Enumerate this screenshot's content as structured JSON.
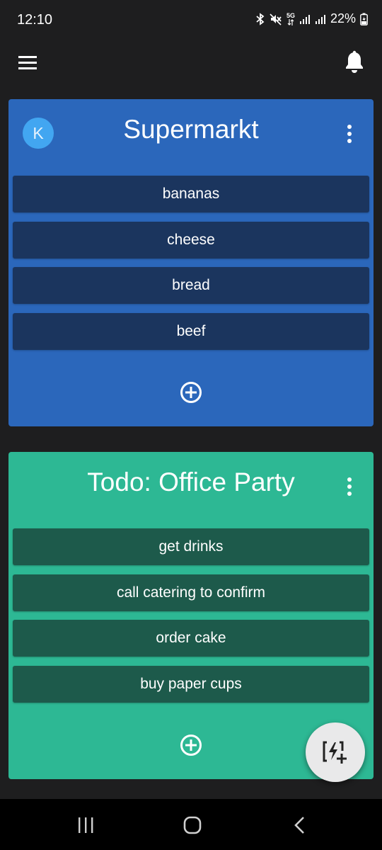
{
  "status_bar": {
    "time": "12:10",
    "network_label": "5G",
    "battery_text": "22%"
  },
  "app_bar": {
    "menu_icon": "menu-icon",
    "notification_icon": "bell-icon"
  },
  "lists": [
    {
      "avatar_letter": "K",
      "title": "Supermarkt",
      "color": "#2b67bb",
      "item_color": "#1b355e",
      "items": [
        "bananas",
        "cheese",
        "bread",
        "beef"
      ]
    },
    {
      "avatar_letter": "",
      "title": "Todo: Office Party",
      "color": "#2db894",
      "item_color": "#1d5a4b",
      "items": [
        "get drinks",
        "call catering to confirm",
        "order cake",
        "buy paper cups"
      ]
    }
  ],
  "fab": {
    "icon": "quick-add-icon"
  },
  "nav_bar": {
    "recents_icon": "recents-icon",
    "home_icon": "home-icon",
    "back_icon": "back-icon"
  }
}
